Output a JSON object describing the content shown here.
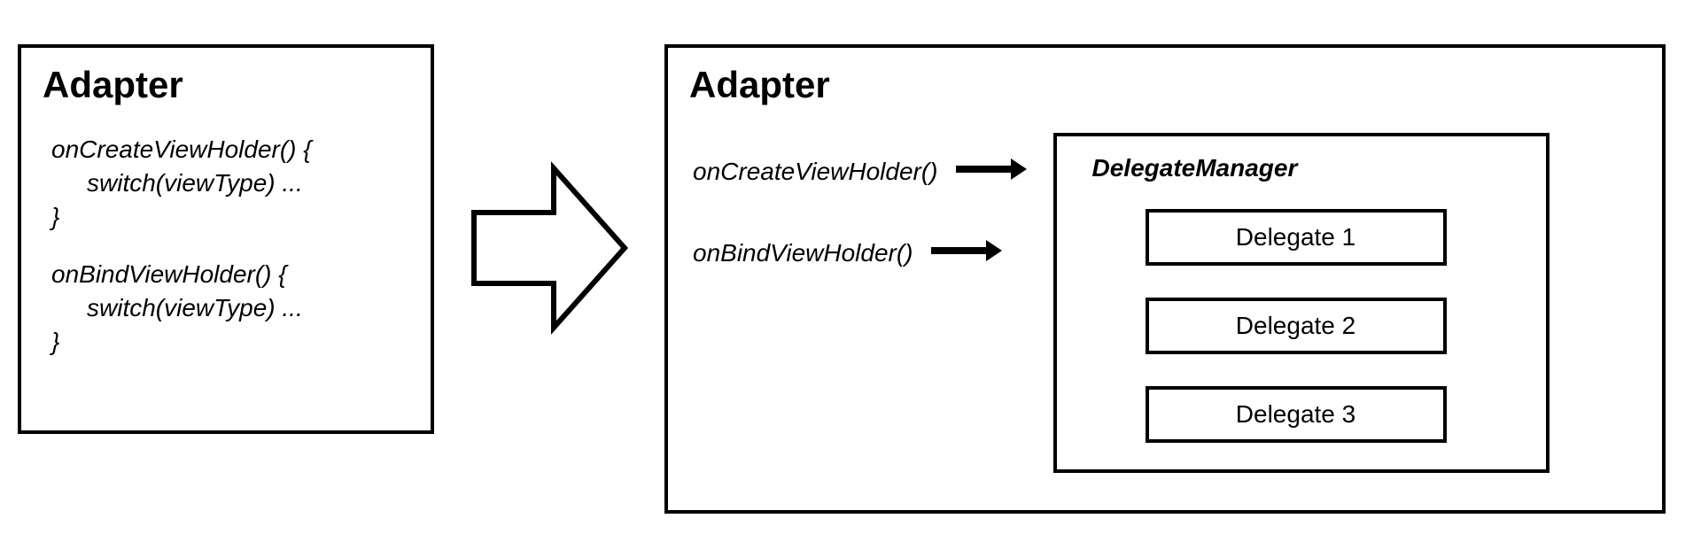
{
  "left": {
    "title": "Adapter",
    "blocks": [
      {
        "sig": "onCreateViewHolder() {",
        "body": "switch(viewType) ...",
        "close": "}"
      },
      {
        "sig": "onBindViewHolder() {",
        "body": "switch(viewType) ...",
        "close": "}"
      }
    ]
  },
  "right": {
    "title": "Adapter",
    "methods": [
      "onCreateViewHolder()",
      "onBindViewHolder()"
    ],
    "delegate_manager": {
      "title": "DelegateManager",
      "delegates": [
        "Delegate 1",
        "Delegate 2",
        "Delegate 3"
      ]
    }
  }
}
